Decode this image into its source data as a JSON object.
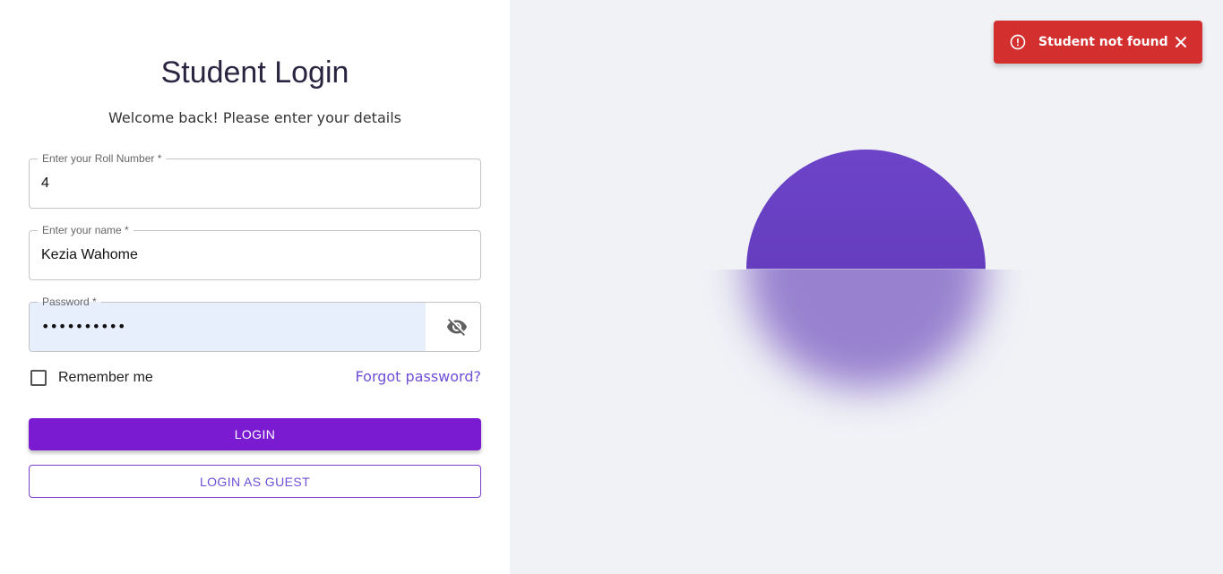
{
  "login": {
    "title": "Student Login",
    "subtitle": "Welcome back! Please enter your details",
    "fields": {
      "roll_number": {
        "label": "Enter your Roll Number *",
        "value": "4"
      },
      "name": {
        "label": "Enter your name *",
        "value": "Kezia Wahome"
      },
      "password": {
        "label": "Password *",
        "masked_value": "••••••••••",
        "toggle_icon": "visibility-off-icon"
      }
    },
    "remember_me": {
      "label": "Remember me",
      "checked": false
    },
    "forgot_password": "Forgot password?",
    "login_button": "LOGIN",
    "guest_button": "LOGIN AS GUEST"
  },
  "toast": {
    "message": "Student not found",
    "icon": "error-outline-icon",
    "close_icon": "close-icon",
    "color": "#d32f2f"
  },
  "colors": {
    "accent": "#7b1bd1",
    "link": "#6e4fd6",
    "orb": "#6d44c8",
    "right_panel_bg": "#f1f2f6"
  }
}
